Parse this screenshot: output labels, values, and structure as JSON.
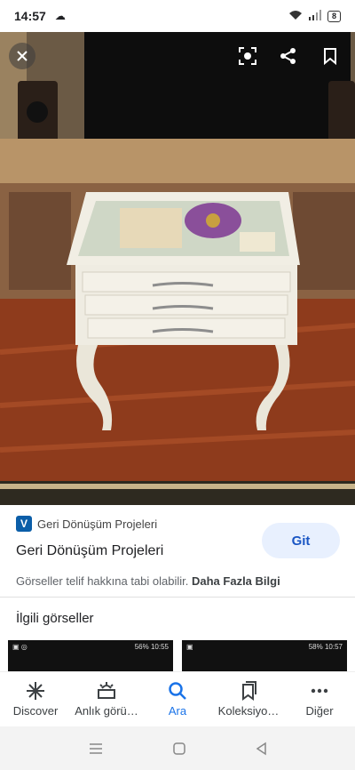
{
  "status": {
    "time": "14:57",
    "battery": "8"
  },
  "source": {
    "name": "Geri Dönüşüm Projeleri",
    "logo_letter": "V"
  },
  "title": "Geri Dönüşüm Projeleri",
  "visit_button": "Git",
  "copyright": {
    "text": "Görseller telif hakkına tabi olabilir.",
    "more": "Daha Fazla Bilgi"
  },
  "related_heading": "İlgili görseller",
  "thumbs": [
    {
      "battery": "56%",
      "time": "10:55"
    },
    {
      "battery": "58%",
      "time": "10:57"
    }
  ],
  "nav": [
    {
      "label": "Discover"
    },
    {
      "label": "Anlık görü…"
    },
    {
      "label": "Ara"
    },
    {
      "label": "Koleksiyo…"
    },
    {
      "label": "Diğer"
    }
  ],
  "colors": {
    "accent": "#1a73e8",
    "button_bg": "#e8f0fe"
  }
}
